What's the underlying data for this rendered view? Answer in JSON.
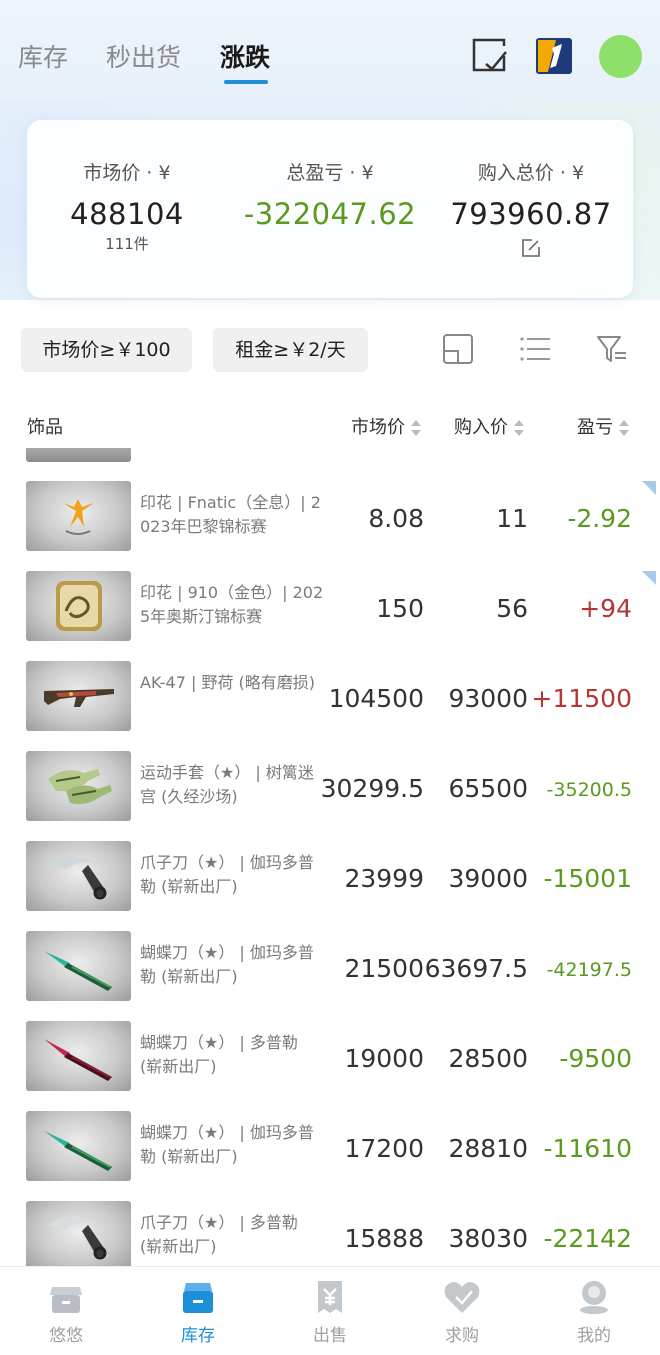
{
  "header": {
    "tabs": [
      {
        "label": "库存",
        "active": false
      },
      {
        "label": "秒出货",
        "active": false
      },
      {
        "label": "涨跌",
        "active": true
      }
    ]
  },
  "summary": {
    "market_label": "市场价 · ¥",
    "market_value": "488104",
    "market_count": "111件",
    "profit_label": "总盈亏 · ¥",
    "profit_value": "-322047.62",
    "cost_label": "购入总价 · ¥",
    "cost_value": "793960.87"
  },
  "filters": {
    "market_chip": "市场价≥￥100",
    "rent_chip": "租金≥￥2/天"
  },
  "table": {
    "headers": {
      "item": "饰品",
      "market": "市场价",
      "buy": "购入价",
      "profit": "盈亏"
    },
    "rows": [
      {
        "name": "印花 | Fnatic（全息）| 2023年巴黎锦标赛",
        "market": "8.08",
        "buy": "11",
        "profit": "-2.92",
        "trend": "down"
      },
      {
        "name": "印花 | 910（金色）| 2025年奥斯汀锦标赛",
        "market": "150",
        "buy": "56",
        "profit": "+94",
        "trend": "up"
      },
      {
        "name": "AK-47 | 野荷 (略有磨损)",
        "market": "104500",
        "buy": "93000",
        "profit": "+11500",
        "trend": "up"
      },
      {
        "name": "运动手套（★） | 树篱迷宫 (久经沙场)",
        "market": "30299.5",
        "buy": "65500",
        "profit": "-35200.5",
        "trend": "down"
      },
      {
        "name": "爪子刀（★） | 伽玛多普勒 (崭新出厂)",
        "market": "23999",
        "buy": "39000",
        "profit": "-15001",
        "trend": "down"
      },
      {
        "name": "蝴蝶刀（★） | 伽玛多普勒 (崭新出厂)",
        "market": "21500",
        "buy": "63697.5",
        "profit": "-42197.5",
        "trend": "down"
      },
      {
        "name": "蝴蝶刀（★） | 多普勒 (崭新出厂)",
        "market": "19000",
        "buy": "28500",
        "profit": "-9500",
        "trend": "down"
      },
      {
        "name": "蝴蝶刀（★） | 伽玛多普勒 (崭新出厂)",
        "market": "17200",
        "buy": "28810",
        "profit": "-11610",
        "trend": "down"
      },
      {
        "name": "爪子刀（★） | 多普勒 (崭新出厂)",
        "market": "15888",
        "buy": "38030",
        "profit": "-22142",
        "trend": "down"
      }
    ]
  },
  "bottom_nav": [
    {
      "label": "悠悠",
      "icon": "store-icon",
      "active": false
    },
    {
      "label": "库存",
      "icon": "inventory-icon",
      "active": true
    },
    {
      "label": "出售",
      "icon": "sell-icon",
      "active": false
    },
    {
      "label": "求购",
      "icon": "wish-icon",
      "active": false
    },
    {
      "label": "我的",
      "icon": "profile-icon",
      "active": false
    }
  ],
  "colors": {
    "accent": "#1d8fd8",
    "loss": "#5a9a1f",
    "gain": "#b43636"
  }
}
